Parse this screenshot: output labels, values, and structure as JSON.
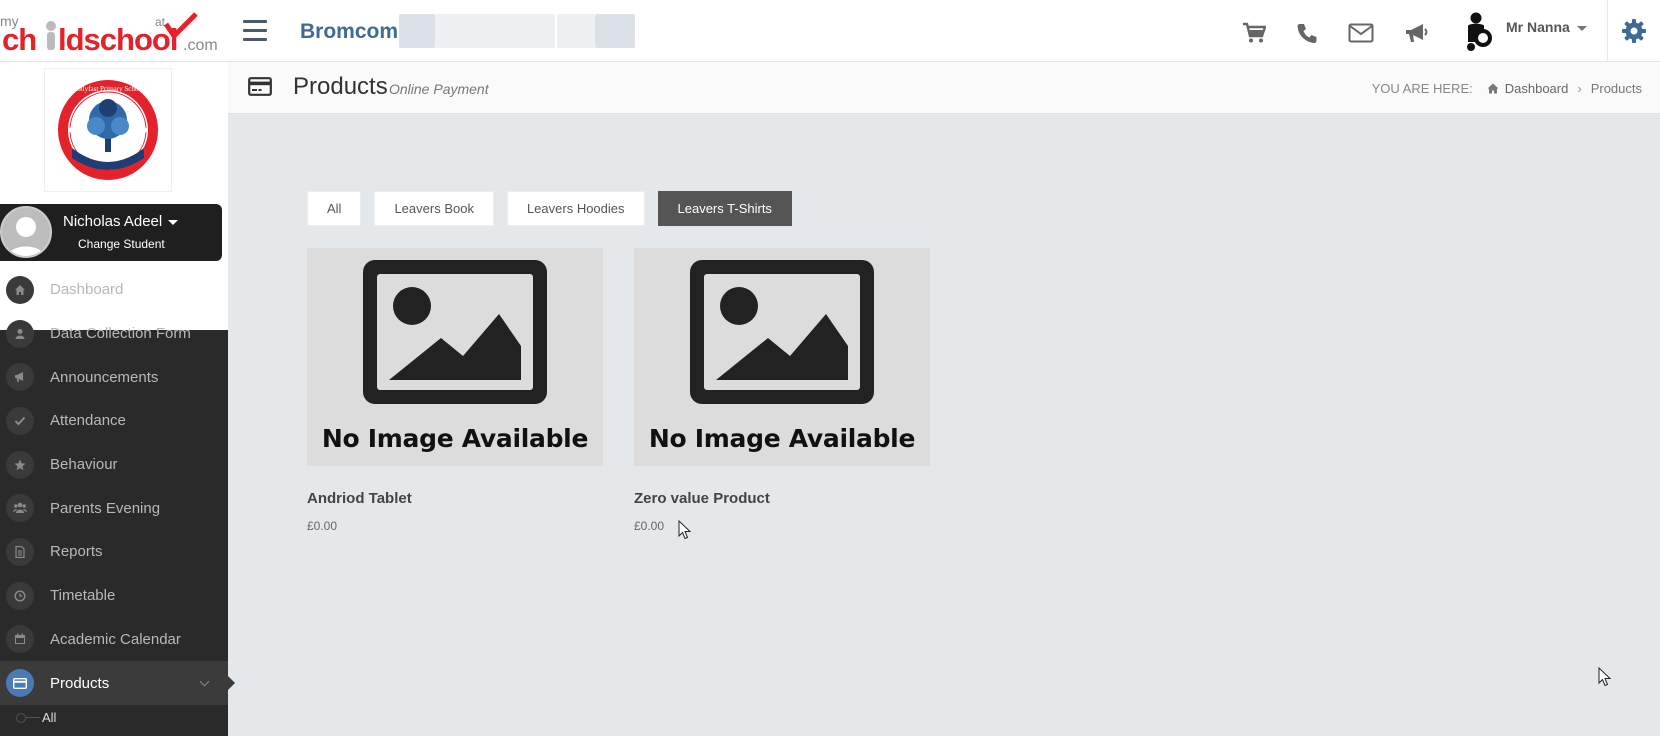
{
  "header": {
    "logo_text": "mychildatschool.com",
    "brand": "Bromcom",
    "user_name": "Mr Nanna"
  },
  "sidebar": {
    "school_name": "Hollyfast Primary School",
    "student": {
      "name": "Nicholas Adeel",
      "change_label": "Change Student"
    },
    "items": [
      {
        "label": "Dashboard",
        "icon": "home-icon"
      },
      {
        "label": "Data Collection Form",
        "icon": "user-icon"
      },
      {
        "label": "Announcements",
        "icon": "megaphone-icon"
      },
      {
        "label": "Attendance",
        "icon": "check-icon"
      },
      {
        "label": "Behaviour",
        "icon": "star-icon"
      },
      {
        "label": "Parents Evening",
        "icon": "users-icon"
      },
      {
        "label": "Reports",
        "icon": "document-icon"
      },
      {
        "label": "Timetable",
        "icon": "clock-icon"
      },
      {
        "label": "Academic Calendar",
        "icon": "calendar-icon"
      },
      {
        "label": "Products",
        "icon": "credit-card-icon",
        "active": true
      }
    ],
    "sub_items": [
      {
        "label": "All"
      }
    ]
  },
  "page": {
    "title": "Products",
    "subtitle": "Online Payment",
    "breadcrumb_label": "YOU ARE HERE:",
    "breadcrumb": [
      "Dashboard",
      "Products"
    ]
  },
  "filters": [
    {
      "label": "All",
      "active": false
    },
    {
      "label": "Leavers Book",
      "active": false
    },
    {
      "label": "Leavers Hoodies",
      "active": false
    },
    {
      "label": "Leavers T-Shirts",
      "active": true
    }
  ],
  "products": [
    {
      "name": "Andriod Tablet",
      "price": "£0.00",
      "image_text": "No Image Available"
    },
    {
      "name": "Zero value Product",
      "price": "£0.00",
      "image_text": "No Image Available"
    }
  ],
  "colors": {
    "brand": "#3e6a96",
    "sidebar_bg": "#2a2a2a",
    "active_filter": "#555555",
    "logo_red": "#e3222b",
    "active_nav_icon": "#4a7bb7"
  }
}
